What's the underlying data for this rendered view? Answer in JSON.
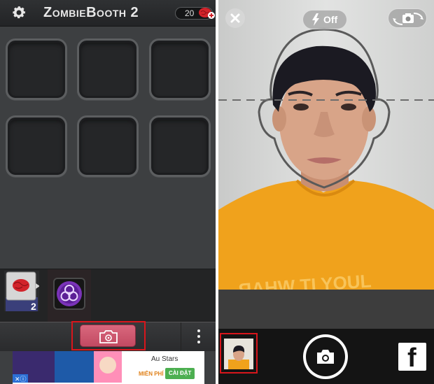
{
  "left_app": {
    "title": "ZombieBooth 2",
    "coin_count": "20",
    "settings_icon": "gear-icon",
    "add_coins_icon": "brain-plus-icon",
    "slot_count": 6,
    "tray_items": [
      "brain-sticker-icon",
      "biohazard-icon"
    ],
    "main_button_icon": "zombie-camera-icon",
    "more_icon": "more-vertical-icon",
    "ad": {
      "title": "Au Stars",
      "free_label": "MIỄN PHÍ",
      "install_label": "CÀI ĐẶT"
    }
  },
  "camera": {
    "close_icon": "close-icon",
    "flash_icon": "flash-icon",
    "flash_label": "Off",
    "flip_icon": "switch-camera-icon",
    "shutter_icon": "camera-icon",
    "share_icon": "facebook-icon",
    "share_label": "f"
  },
  "colors": {
    "accent_pink": "#c94d66",
    "highlight_red": "#d8161c",
    "panel_dark": "#3d3f41",
    "shirt_orange": "#f0a21c"
  }
}
